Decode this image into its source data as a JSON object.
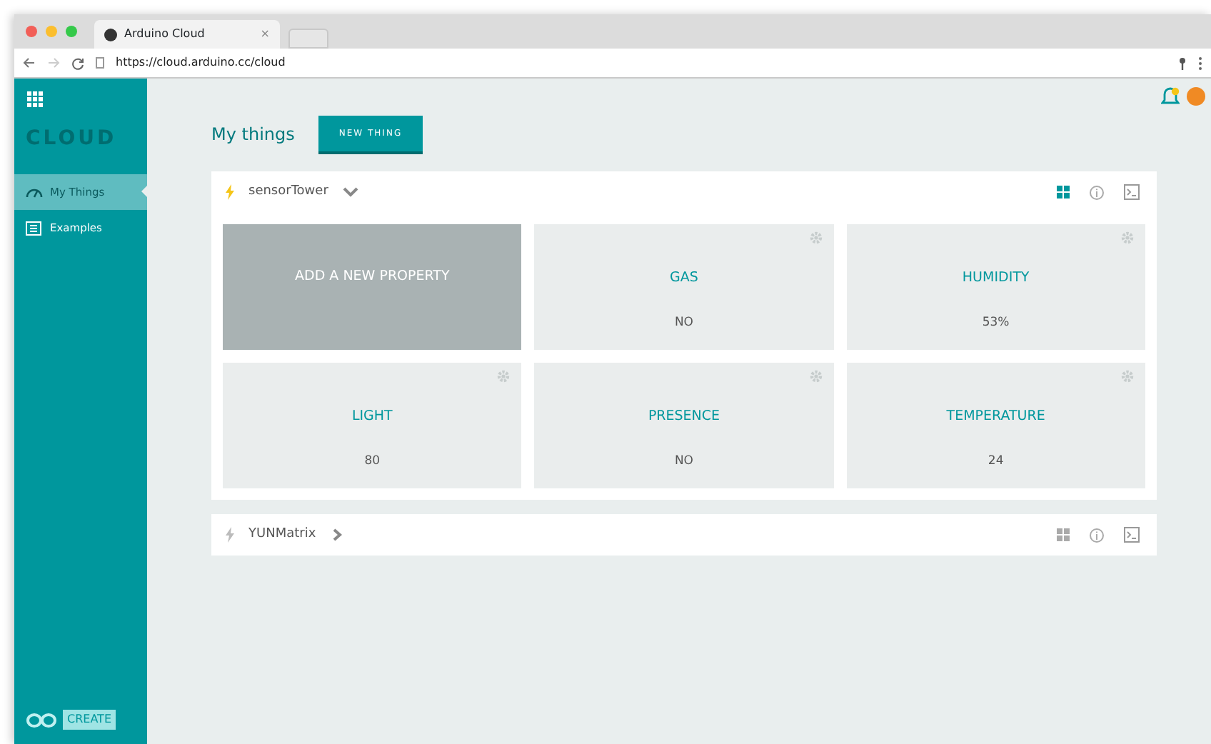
{
  "browser": {
    "tab_title": "Arduino Cloud",
    "tab_close": "×",
    "url": "https://cloud.arduino.cc/cloud"
  },
  "sidebar": {
    "logo": "CLOUD",
    "items": [
      {
        "label": "My Things",
        "selected": true
      },
      {
        "label": "Examples",
        "selected": false
      }
    ],
    "footer": "CREATE"
  },
  "header": {
    "title": "My things",
    "new_button": "NEW THING",
    "notification": true
  },
  "things": [
    {
      "name": "sensorTower",
      "online": true,
      "expanded": true,
      "properties": [
        {
          "kind": "add",
          "label": "ADD A NEW PROPERTY"
        },
        {
          "kind": "property",
          "name": "GAS",
          "value": "NO"
        },
        {
          "kind": "property",
          "name": "HUMIDITY",
          "value": "53%"
        },
        {
          "kind": "property",
          "name": "LIGHT",
          "value": "80"
        },
        {
          "kind": "property",
          "name": "PRESENCE",
          "value": "NO"
        },
        {
          "kind": "property",
          "name": "TEMPERATURE",
          "value": "24"
        }
      ]
    },
    {
      "name": "YUNMatrix",
      "online": false,
      "expanded": false
    }
  ]
}
